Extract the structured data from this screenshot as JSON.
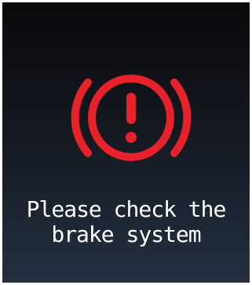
{
  "warning": {
    "icon": "brake-warning-icon",
    "color": "#e8222a",
    "message_line1": "Please check the",
    "message_line2": "brake system"
  }
}
